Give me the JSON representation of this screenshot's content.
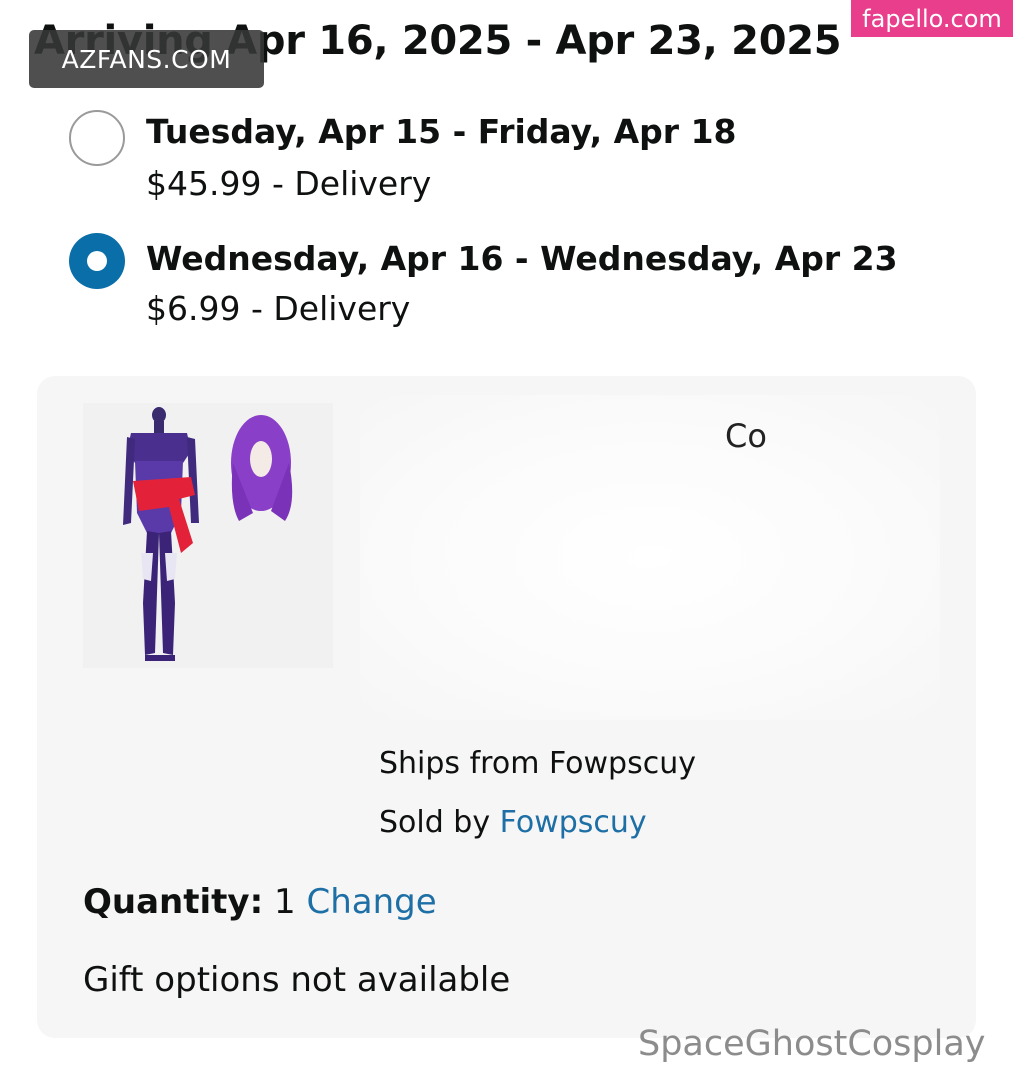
{
  "header": {
    "arrival_title": "Arriving Apr 16, 2025 - Apr 23, 2025"
  },
  "watermarks": {
    "top_left": "AZFANS.COM",
    "top_right": "fapello.com",
    "bottom_right": "SpaceGhostCosplay"
  },
  "delivery_options": [
    {
      "date_range": "Tuesday, Apr 15 - Friday, Apr 18",
      "price_text": "$45.99 - Delivery",
      "selected": false
    },
    {
      "date_range": "Wednesday, Apr 16 - Wednesday, Apr 23",
      "price_text": "$6.99 - Delivery",
      "selected": true
    }
  ],
  "item": {
    "image_alt": "purple cosplay bodysuit with red sash and purple wig",
    "title_fragment": "Co",
    "ships_from": "Ships from Fowpscuy",
    "sold_by_label": "Sold by",
    "seller": "Fowpscuy",
    "quantity_label": "Quantity:",
    "quantity_value": "1",
    "change_label": "Change",
    "gift_text": "Gift options not available"
  },
  "colors": {
    "accent": "#0a6ea8",
    "link": "#1d6fa5",
    "card_bg": "#f6f6f6",
    "watermark_pink": "#e83e8c"
  }
}
